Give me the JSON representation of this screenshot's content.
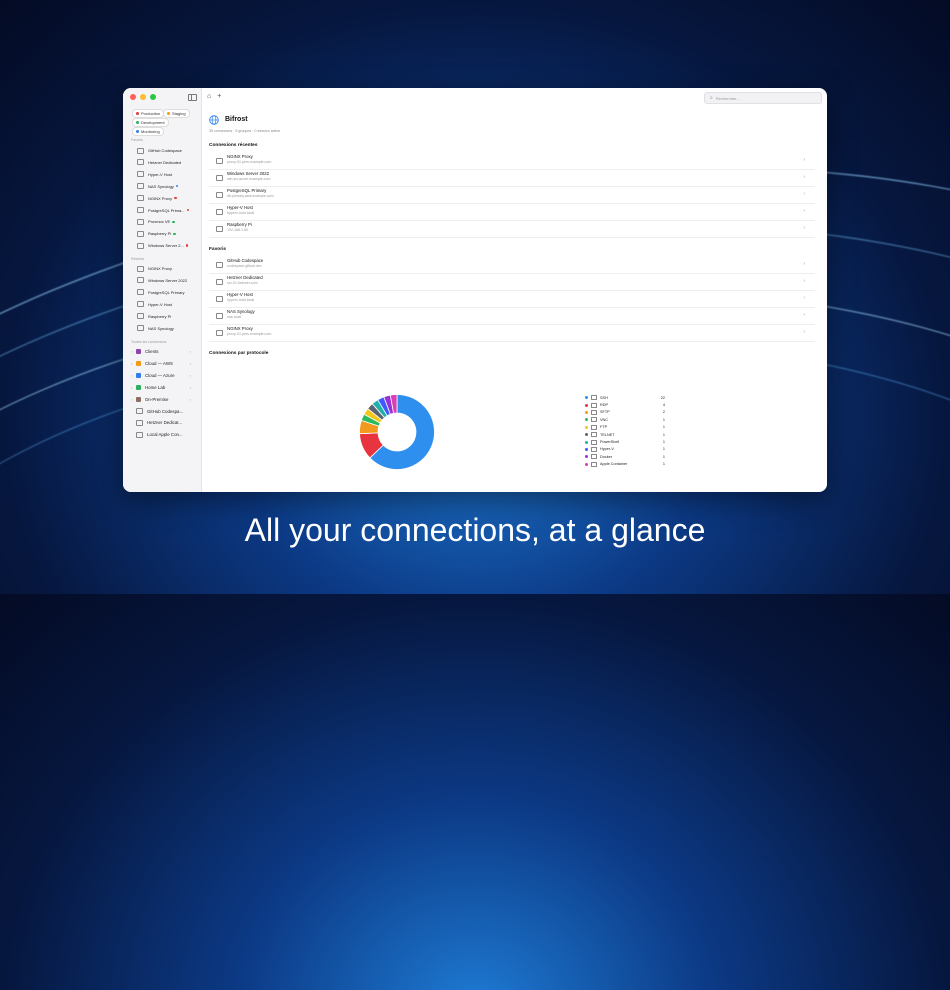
{
  "caption": "All your connections, at a glance",
  "window": {
    "traffic_colors": [
      "#ff5f57",
      "#febc2e",
      "#28c840"
    ]
  },
  "sidebar": {
    "tags": [
      {
        "label": "Production",
        "color": "#e23b3b"
      },
      {
        "label": "Staging",
        "color": "#f39c12"
      },
      {
        "label": "Development",
        "color": "#2eb05c"
      },
      {
        "label": "Monitoring",
        "color": "#2f80ed"
      }
    ],
    "favorites_label": "Favoris",
    "favorites": [
      {
        "label": "GitHub Codespace",
        "dot": ""
      },
      {
        "label": "Hetzner Dedicated",
        "dot": ""
      },
      {
        "label": "Hyper-V Host",
        "dot": ""
      },
      {
        "label": "NAS Synology",
        "dot": "#2f80ed"
      },
      {
        "label": "NGINX Proxy",
        "dot": "#e23b3b"
      },
      {
        "label": "PostgreSQL Prima...",
        "dot": "#e23b3b"
      },
      {
        "label": "Proxmox VE",
        "dot": "#2eb05c"
      },
      {
        "label": "Raspberry Pi",
        "dot": "#2eb05c"
      },
      {
        "label": "Windows Server 2...",
        "dot": "#e23b3b"
      }
    ],
    "recent_label": "Récents",
    "recent": [
      {
        "label": "NGINX Proxy"
      },
      {
        "label": "Windows Server 2022"
      },
      {
        "label": "PostgreSQL Primary"
      },
      {
        "label": "Hyper-V Host"
      },
      {
        "label": "Raspberry Pi"
      },
      {
        "label": "NAS Synology"
      }
    ],
    "all_label": "Toutes les connexions",
    "groups": [
      {
        "label": "Clients",
        "color": "#8e44ad",
        "expandable": true
      },
      {
        "label": "Cloud — AWS",
        "color": "#f39c12",
        "expandable": true
      },
      {
        "label": "Cloud — Azure",
        "color": "#2f80ed",
        "expandable": true
      },
      {
        "label": "Home Lab",
        "color": "#2eb05c",
        "expandable": true
      },
      {
        "label": "On-Premise",
        "color": "#8d6e63",
        "expandable": true
      },
      {
        "label": "GitHub Codespa...",
        "color": "",
        "expandable": false
      },
      {
        "label": "Hetzner Dedicat...",
        "color": "",
        "expandable": false
      },
      {
        "label": "Local Apple Con...",
        "color": "",
        "expandable": false
      }
    ]
  },
  "search": {
    "placeholder": "Rechercher..."
  },
  "main": {
    "title": "Bifrost",
    "subtitle": "35 connexions · 5 groupes · 0 session active",
    "recent_heading": "Connexions récentes",
    "recent_rows": [
      {
        "name": "NGINX Proxy",
        "host": "proxy-01.pers.example.com"
      },
      {
        "name": "Windows Server 2022",
        "host": "win-srv.azure.example.com"
      },
      {
        "name": "PostgreSQL Primary",
        "host": "db-primary.aws.example.com"
      },
      {
        "name": "Hyper-V Host",
        "host": "hyperv-host.local"
      },
      {
        "name": "Raspberry Pi",
        "host": "192.168.1.50"
      }
    ],
    "favorites_heading": "Favoris",
    "favorite_rows": [
      {
        "name": "GitHub Codespace",
        "host": "codespace.github.dev"
      },
      {
        "name": "Hetzner Dedicated",
        "host": "srv-01.hetzner.com"
      },
      {
        "name": "Hyper-V Host",
        "host": "hyperv-host.local"
      },
      {
        "name": "NAS Synology",
        "host": "nas.local"
      },
      {
        "name": "NGINX Proxy",
        "host": "proxy-01.pers.example.com"
      }
    ],
    "protocol_heading": "Connexions par protocole"
  },
  "chart_data": {
    "type": "pie",
    "title": "Connexions par protocole",
    "donut": true,
    "series": [
      {
        "name": "SSH",
        "value": 22,
        "color": "#2f8fef"
      },
      {
        "name": "RDP",
        "value": 4,
        "color": "#e8343f"
      },
      {
        "name": "SFTP",
        "value": 2,
        "color": "#f39a1e"
      },
      {
        "name": "VNC",
        "value": 1,
        "color": "#2eb85c"
      },
      {
        "name": "FTP",
        "value": 1,
        "color": "#f2c81d"
      },
      {
        "name": "TELNET",
        "value": 1,
        "color": "#5b6470"
      },
      {
        "name": "PowerShell",
        "value": 1,
        "color": "#20b2aa"
      },
      {
        "name": "Hyper-V",
        "value": 1,
        "color": "#3d5afe"
      },
      {
        "name": "Docker",
        "value": 1,
        "color": "#9b30d9"
      },
      {
        "name": "Apple Container",
        "value": 1,
        "color": "#d63fb5"
      }
    ]
  }
}
